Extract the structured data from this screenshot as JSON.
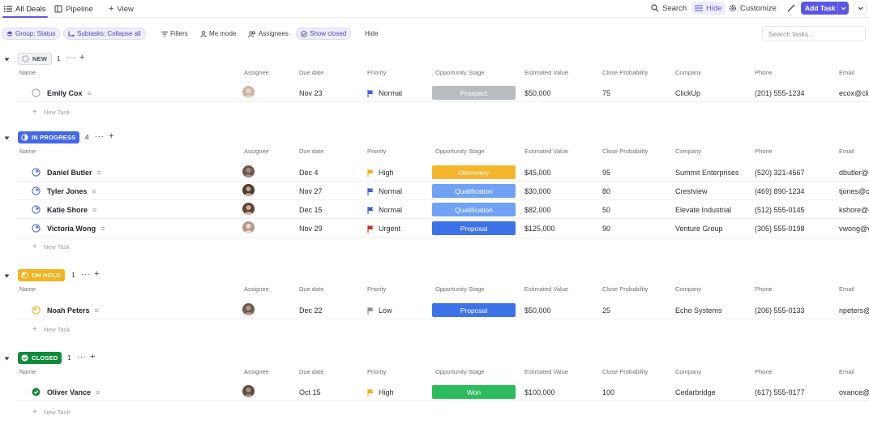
{
  "topbar": {
    "tabs": [
      {
        "label": "All Deals",
        "icon": "list-icon",
        "active": true
      },
      {
        "label": "Pipeline",
        "icon": "board-icon",
        "active": false
      },
      {
        "label": "View",
        "icon": "plus-icon",
        "active": false
      }
    ],
    "search_label": "Search",
    "hide_label": "Hide",
    "customize_label": "Customize",
    "add_task_label": "Add Task"
  },
  "filterbar": {
    "group_chip": "Group: Status",
    "subtasks_chip": "Subtasks: Collapse all",
    "filters": "Filters",
    "me_mode": "Me mode",
    "assignees": "Assignees",
    "show_closed": "Show closed",
    "hide": "Hide",
    "search_placeholder": "Search tasks..."
  },
  "columns": {
    "name": "Name",
    "assignee": "Assignee",
    "due": "Due date",
    "priority": "Priority",
    "stage": "Opportunity Stage",
    "value": "Estimated Value",
    "prob": "Close Probability",
    "company": "Company",
    "phone": "Phone",
    "email": "Email"
  },
  "new_task_label": "New Task",
  "colors": {
    "accent": "#5b57e6",
    "new": "#9ca0a8",
    "in_progress": "#4569e6",
    "on_hold": "#f2b31d",
    "closed": "#118a3c",
    "prospect": "#b8bbc0",
    "discovery": "#f5b52d",
    "qualification": "#6fa2f4",
    "proposal": "#3d72e9",
    "won": "#2dbb5e"
  },
  "groups": [
    {
      "id": "new",
      "label": "NEW",
      "count": "1",
      "rows": [
        {
          "name": "Emily Cox",
          "due": "Nov 23",
          "priority": "Normal",
          "priority_color": "#3a5ed8",
          "stage": "Prospect",
          "stage_color": "#b8bbc0",
          "value": "$50,000",
          "prob": "75",
          "company": "ClickUp",
          "phone": "(201) 555-1234",
          "email": "ecox@clickup.com",
          "avatar_color": "#c9b6a6"
        }
      ]
    },
    {
      "id": "in_progress",
      "label": "IN PROGRESS",
      "count": "4",
      "rows": [
        {
          "name": "Daniel Butler",
          "due": "Dec 4",
          "priority": "High",
          "priority_color": "#e8b015",
          "stage": "Discovery",
          "stage_color": "#f5b52d",
          "value": "$45,000",
          "prob": "95",
          "company": "Summit Enterprises",
          "phone": "(520) 321-4567",
          "email": "dbutler@summit.com",
          "avatar_color": "#6a5a52"
        },
        {
          "name": "Tyler Jones",
          "due": "Nov 27",
          "priority": "Normal",
          "priority_color": "#3a5ed8",
          "stage": "Qualification",
          "stage_color": "#6fa2f4",
          "value": "$30,000",
          "prob": "80",
          "company": "Crestview",
          "phone": "(469) 890-1234",
          "email": "tjones@crestview.com",
          "avatar_color": "#4b3b33"
        },
        {
          "name": "Katie Shore",
          "due": "Dec 15",
          "priority": "Normal",
          "priority_color": "#3a5ed8",
          "stage": "Qualification",
          "stage_color": "#6fa2f4",
          "value": "$82,000",
          "prob": "50",
          "company": "Elevate Industrial",
          "phone": "(512) 555-0145",
          "email": "kshore@elevate.com",
          "avatar_color": "#5a4338"
        },
        {
          "name": "Victoria Wong",
          "due": "Nov 29",
          "priority": "Urgent",
          "priority_color": "#c0392b",
          "stage": "Proposal",
          "stage_color": "#3d72e9",
          "value": "$125,000",
          "prob": "90",
          "company": "Venture Group",
          "phone": "(305) 555-0198",
          "email": "vwong@venture.com",
          "avatar_color": "#b59a8c"
        }
      ]
    },
    {
      "id": "on_hold",
      "label": "ON HOLD",
      "count": "1",
      "rows": [
        {
          "name": "Noah Peters",
          "due": "Dec 22",
          "priority": "Low",
          "priority_color": "#8a8f98",
          "stage": "Proposal",
          "stage_color": "#3d72e9",
          "value": "$50,000",
          "prob": "25",
          "company": "Echo Systems",
          "phone": "(206) 555-0133",
          "email": "npeters@echo.com",
          "avatar_color": "#6e5c50"
        }
      ]
    },
    {
      "id": "closed",
      "label": "CLOSED",
      "count": "1",
      "rows": [
        {
          "name": "Oliver Vance",
          "due": "Oct 15",
          "priority": "High",
          "priority_color": "#e8b015",
          "stage": "Won",
          "stage_color": "#2dbb5e",
          "value": "$100,000",
          "prob": "100",
          "company": "Cedarbridge",
          "phone": "(617) 555-0177",
          "email": "ovance@cedarbridge.com",
          "avatar_color": "#5f4e46"
        }
      ]
    }
  ]
}
